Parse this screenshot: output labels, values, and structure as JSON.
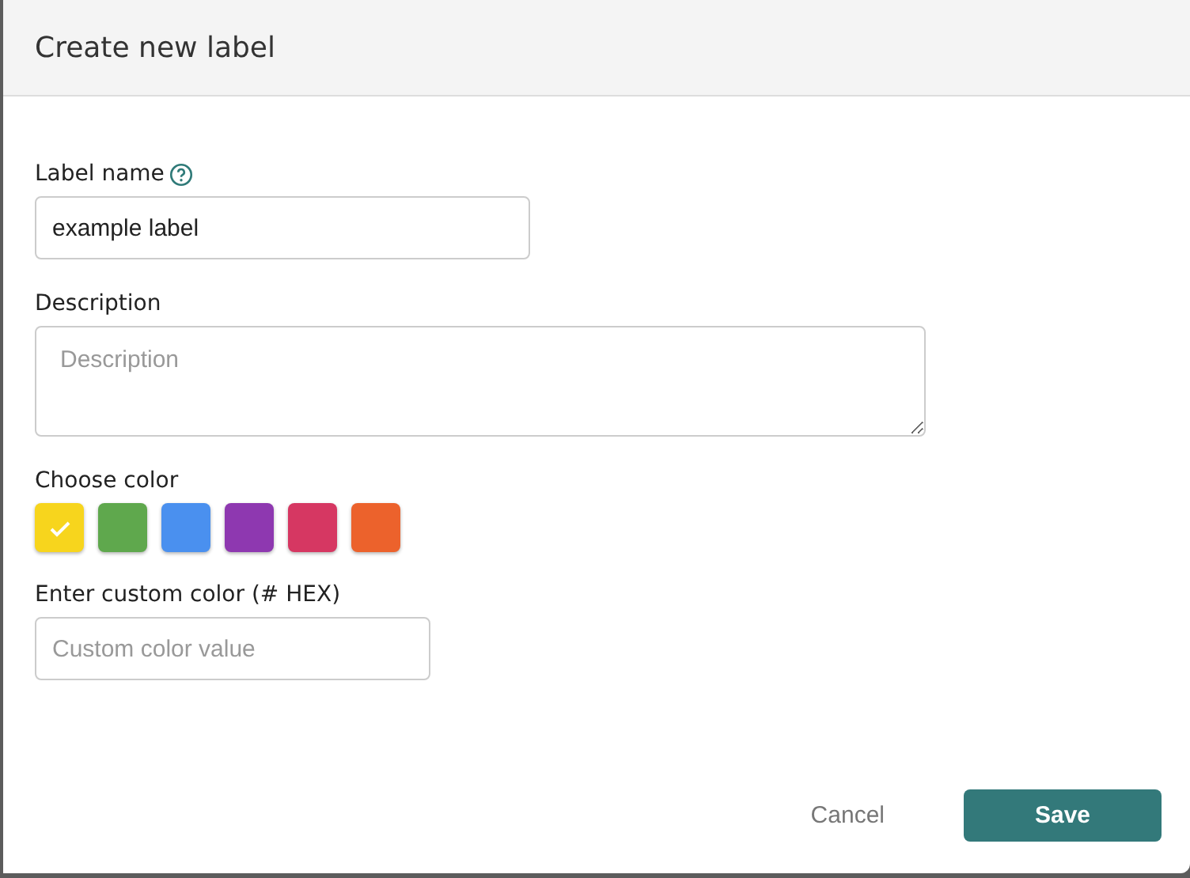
{
  "dialog": {
    "title": "Create new label"
  },
  "label_name": {
    "label": "Label name",
    "value": "example label"
  },
  "description": {
    "label": "Description",
    "placeholder": "Description"
  },
  "choose_color": {
    "label": "Choose color",
    "swatches": [
      {
        "color": "#f7d51d",
        "selected": true
      },
      {
        "color": "#5fa84d",
        "selected": false
      },
      {
        "color": "#4a90ef",
        "selected": false
      },
      {
        "color": "#8e38b0",
        "selected": false
      },
      {
        "color": "#d63762",
        "selected": false
      },
      {
        "color": "#ec622c",
        "selected": false
      }
    ]
  },
  "custom_color": {
    "label": "Enter custom color (# HEX)",
    "placeholder": "Custom color value"
  },
  "buttons": {
    "cancel": "Cancel",
    "save": "Save"
  }
}
